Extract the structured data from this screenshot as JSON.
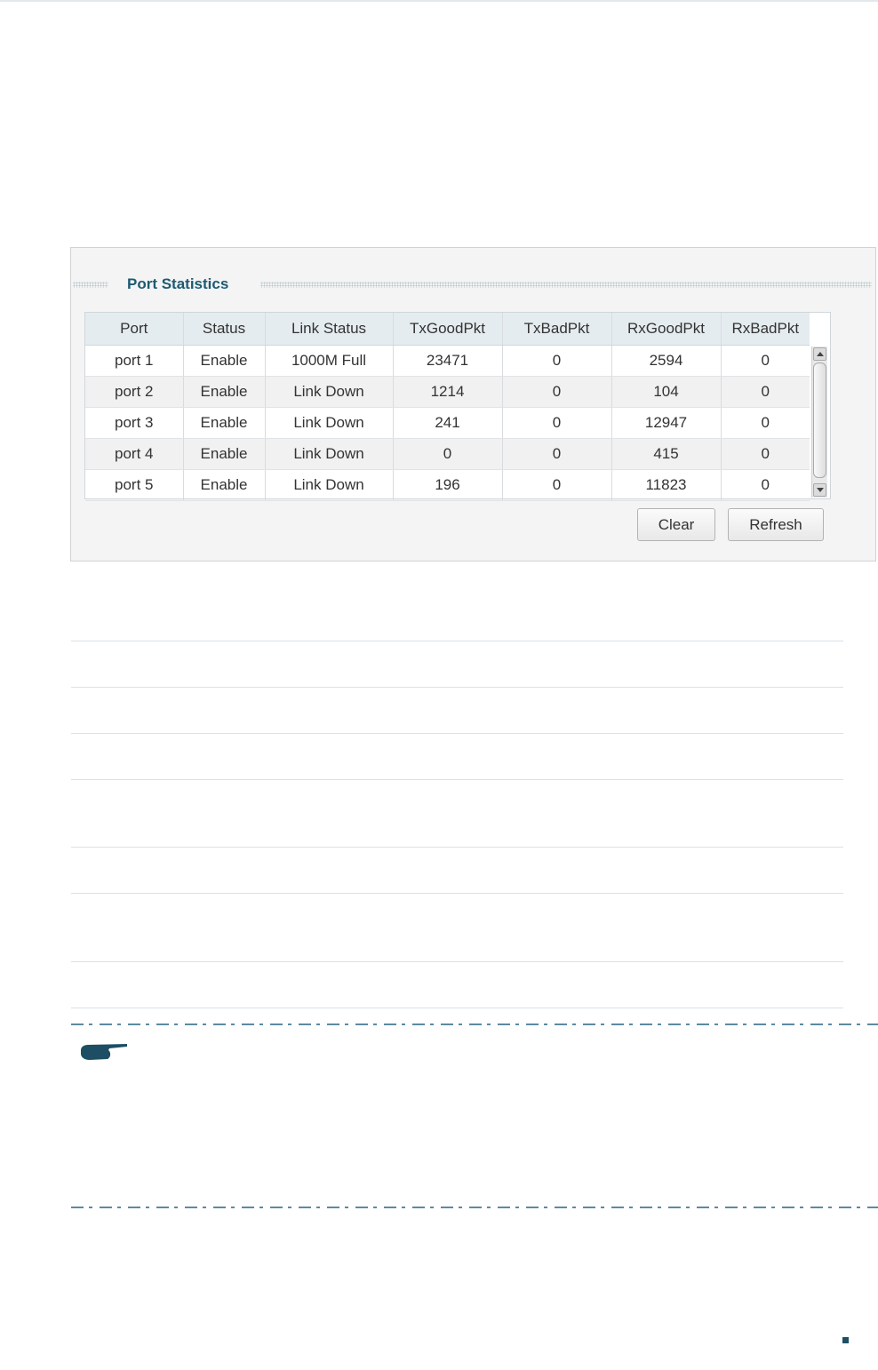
{
  "panel": {
    "title": "Port Statistics",
    "columns": [
      "Port",
      "Status",
      "Link Status",
      "TxGoodPkt",
      "TxBadPkt",
      "RxGoodPkt",
      "RxBadPkt"
    ],
    "rows": [
      [
        "port 1",
        "Enable",
        "1000M Full",
        "23471",
        "0",
        "2594",
        "0"
      ],
      [
        "port 2",
        "Enable",
        "Link Down",
        "1214",
        "0",
        "104",
        "0"
      ],
      [
        "port 3",
        "Enable",
        "Link Down",
        "241",
        "0",
        "12947",
        "0"
      ],
      [
        "port 4",
        "Enable",
        "Link Down",
        "0",
        "0",
        "415",
        "0"
      ],
      [
        "port 5",
        "Enable",
        "Link Down",
        "196",
        "0",
        "11823",
        "0"
      ]
    ],
    "buttons": {
      "clear": "Clear",
      "refresh": "Refresh"
    }
  },
  "icons": {
    "note": "pointing-hand-icon",
    "scroll_up": "arrow-up-icon",
    "scroll_down": "arrow-down-icon"
  },
  "colors": {
    "title": "#1d5a72",
    "header_bg": "#e5ecef",
    "accent_dash": "#5d8aa0"
  }
}
